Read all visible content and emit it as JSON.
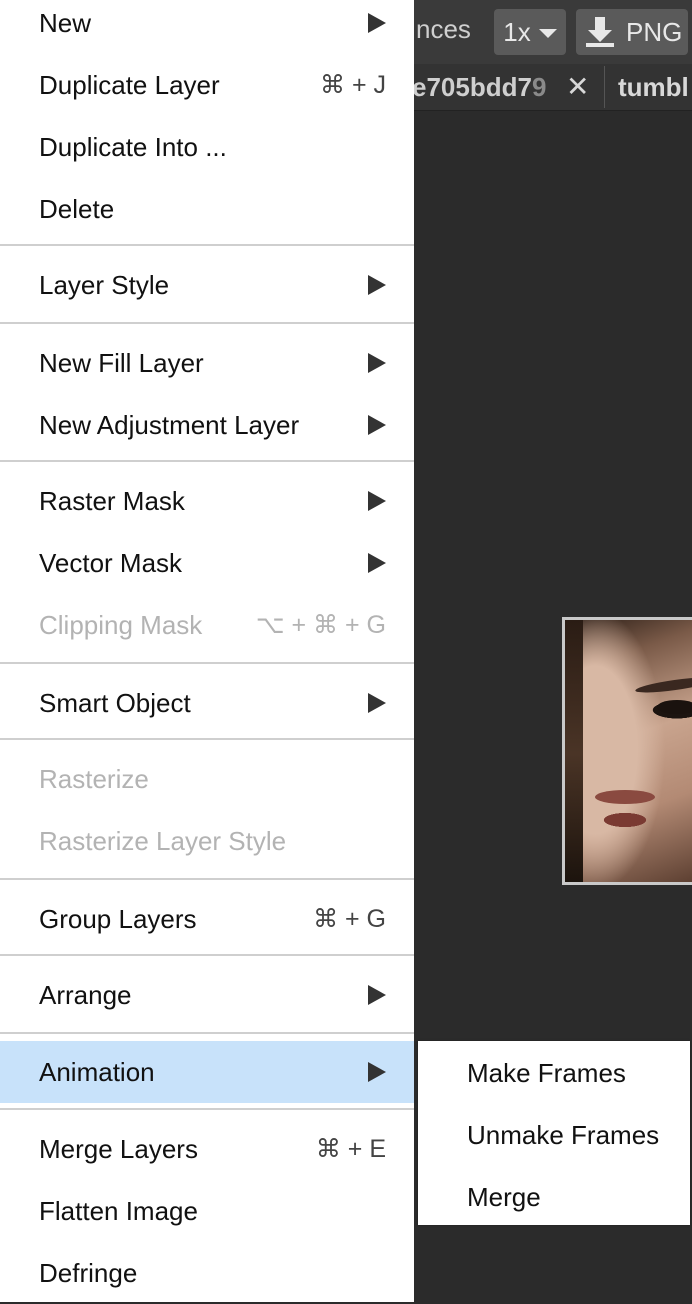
{
  "editor": {
    "topbar_fragment": "nces",
    "zoom_label": "1x",
    "export_label": "PNG",
    "tabs": [
      {
        "label_main": "e705bdd7",
        "label_fade": "9"
      },
      {
        "label": "tumbl"
      }
    ],
    "tab_close": "✕"
  },
  "menu": {
    "items": [
      {
        "label": "New",
        "submenu": true
      },
      {
        "label": "Duplicate Layer",
        "shortcut": "⌘ + J"
      },
      {
        "label": "Duplicate Into ..."
      },
      {
        "label": "Delete"
      },
      {
        "label": "Layer Style",
        "submenu": true
      },
      {
        "label": "New Fill Layer",
        "submenu": true
      },
      {
        "label": "New Adjustment Layer",
        "submenu": true
      },
      {
        "label": "Raster Mask",
        "submenu": true
      },
      {
        "label": "Vector Mask",
        "submenu": true
      },
      {
        "label": "Clipping Mask",
        "shortcut": "⌥ + ⌘ + G",
        "disabled": true
      },
      {
        "label": "Smart Object",
        "submenu": true
      },
      {
        "label": "Rasterize",
        "disabled": true
      },
      {
        "label": "Rasterize Layer Style",
        "disabled": true
      },
      {
        "label": "Group Layers",
        "shortcut": "⌘ + G"
      },
      {
        "label": "Arrange",
        "submenu": true
      },
      {
        "label": "Animation",
        "submenu": true,
        "highlighted": true
      },
      {
        "label": "Merge Layers",
        "shortcut": "⌘ + E"
      },
      {
        "label": "Flatten Image"
      },
      {
        "label": "Defringe"
      }
    ],
    "highlight_color": "#c8e2fa"
  },
  "submenu": {
    "items": [
      {
        "label": "Make Frames"
      },
      {
        "label": "Unmake Frames"
      },
      {
        "label": "Merge"
      }
    ]
  }
}
